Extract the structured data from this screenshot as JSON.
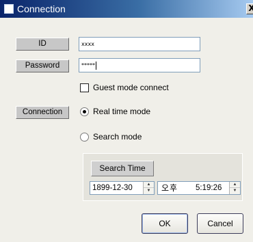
{
  "window": {
    "title": "Connection"
  },
  "title_icon": "window-icon",
  "close_symbol": "X",
  "fields": {
    "id_label": "ID",
    "id_value": "xxxx",
    "password_label": "Password",
    "password_value": "*****"
  },
  "guest_mode": {
    "label": "Guest mode connect",
    "checked": false
  },
  "connection": {
    "label": "Connection",
    "modes": [
      {
        "label": "Real time mode",
        "selected": true
      },
      {
        "label": "Search mode",
        "selected": false
      }
    ]
  },
  "search": {
    "button_label": "Search Time",
    "date_value": "1899-12-30",
    "ampm_value": "오후",
    "time_value": "5:19:26"
  },
  "buttons": {
    "ok": "OK",
    "cancel": "Cancel"
  },
  "colors": {
    "title_start": "#0a246a",
    "title_end": "#a6caf0",
    "dialog_bg": "#f0efe9"
  }
}
